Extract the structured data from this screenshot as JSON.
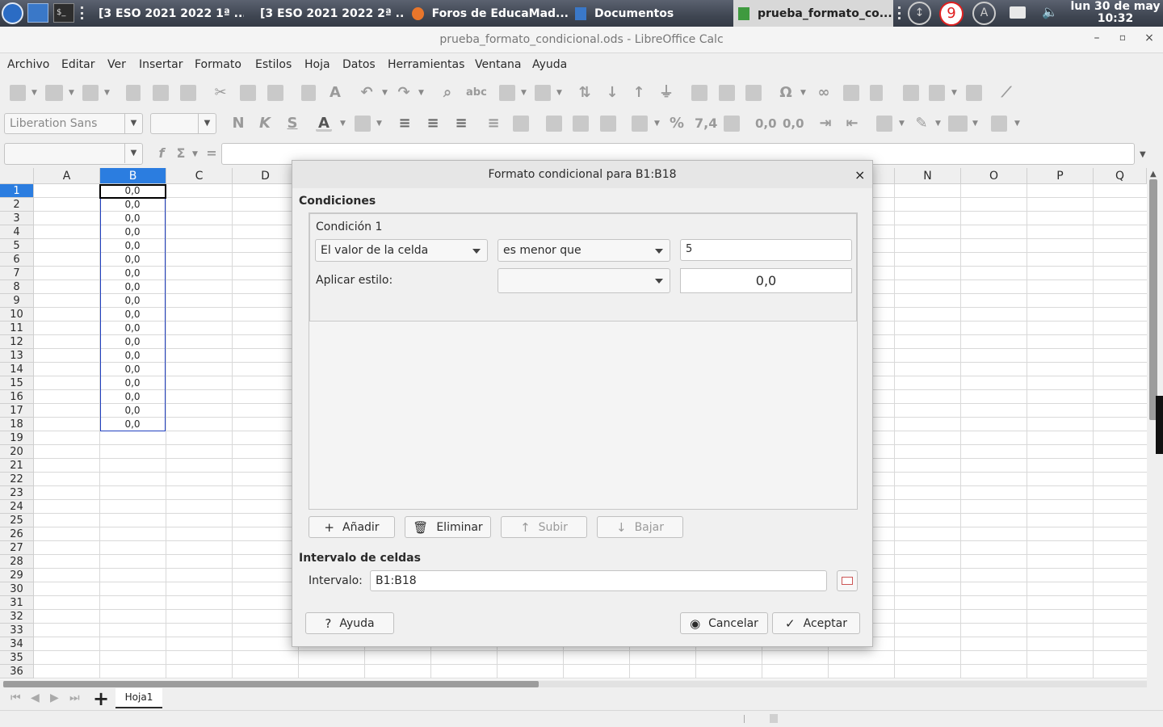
{
  "taskbar": {
    "windows": [
      {
        "label": "[3 ESO 2021 2022 1ª ..."
      },
      {
        "label": "[3 ESO 2021 2022 2ª ..."
      },
      {
        "label": "Foros de EducaMad..."
      },
      {
        "label": "Documentos"
      },
      {
        "label": "prueba_formato_co..."
      }
    ],
    "notification_count": "9",
    "clock_date": "lun 30 de may",
    "clock_time": "10:32"
  },
  "window": {
    "title": "prueba_formato_condicional.ods - LibreOffice Calc"
  },
  "menu": [
    "Archivo",
    "Editar",
    "Ver",
    "Insertar",
    "Formato",
    "Estilos",
    "Hoja",
    "Datos",
    "Herramientas",
    "Ventana",
    "Ayuda"
  ],
  "format_toolbar": {
    "font_name": "Liberation Sans",
    "bold": "N",
    "italic": "K",
    "underline": "S",
    "percent": "%",
    "number": "7,4"
  },
  "formula_bar": {
    "fx": "f",
    "sum": "Σ",
    "equals": "="
  },
  "sheet": {
    "columns": [
      "A",
      "B",
      "C",
      "D",
      "N",
      "O",
      "P",
      "Q"
    ],
    "selected_column": "B",
    "rows": [
      "1",
      "2",
      "3",
      "4",
      "5",
      "6",
      "7",
      "8",
      "9",
      "10",
      "11",
      "12",
      "13",
      "14",
      "15",
      "16",
      "17",
      "18",
      "19",
      "20",
      "21",
      "22",
      "23",
      "24",
      "25",
      "26",
      "27",
      "28",
      "29",
      "30",
      "31",
      "32",
      "33",
      "34",
      "35",
      "36"
    ],
    "column_b_values": [
      "0,0",
      "0,0",
      "0,0",
      "0,0",
      "0,0",
      "0,0",
      "0,0",
      "0,0",
      "0,0",
      "0,0",
      "0,0",
      "0,0",
      "0,0",
      "0,0",
      "0,0",
      "0,0",
      "0,0",
      "0,0"
    ],
    "tab": "Hoja1"
  },
  "dialog": {
    "title": "Formato condicional para B1:B18",
    "conditions_heading": "Condiciones",
    "condition_label": "Condición 1",
    "type_select": "El valor de la celda",
    "operator_select": "es menor que",
    "value": "5",
    "apply_style_label": "Aplicar estilo:",
    "style_select": "",
    "preview": "0,0",
    "buttons": {
      "add": "Añadir",
      "remove": "Eliminar",
      "up": "Subir",
      "down": "Bajar"
    },
    "range_heading": "Intervalo de celdas",
    "range_label": "Intervalo:",
    "range_value": "B1:B18",
    "help": "Ayuda",
    "cancel": "Cancelar",
    "ok": "Aceptar"
  }
}
